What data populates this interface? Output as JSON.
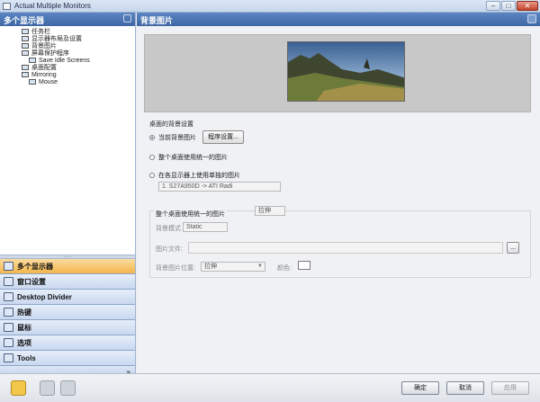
{
  "window": {
    "title": "Actual Multiple Monitors",
    "buttons": {
      "minimize": "–",
      "maximize": "□",
      "close": "✕"
    }
  },
  "left": {
    "header": "多个显示器",
    "tree": [
      {
        "label": "任务栏",
        "level": 2
      },
      {
        "label": "显示器布局及设置",
        "level": 2
      },
      {
        "label": "背景图片",
        "level": 2
      },
      {
        "label": "屏幕保护程序",
        "level": 2
      },
      {
        "label": "Save Idle Screens",
        "level": 3
      },
      {
        "label": "桌面配置",
        "level": 2
      },
      {
        "label": "Mirroring",
        "level": 2
      },
      {
        "label": "Mouse",
        "level": 3
      }
    ],
    "grip": "......",
    "nav": [
      {
        "label": "多个显示器",
        "active": true,
        "icon": "monitors-icon"
      },
      {
        "label": "窗口设置",
        "active": false,
        "icon": "window-icon"
      },
      {
        "label": "Desktop Divider",
        "active": false,
        "icon": "divider-icon"
      },
      {
        "label": "热键",
        "active": false,
        "icon": "keyboard-icon"
      },
      {
        "label": "鼠标",
        "active": false,
        "icon": "mouse-icon"
      },
      {
        "label": "选项",
        "active": false,
        "icon": "options-icon"
      },
      {
        "label": "Tools",
        "active": false,
        "icon": "tools-icon"
      }
    ],
    "nav_footer": "»"
  },
  "right": {
    "header": "背景图片",
    "section_label": "桌面的背景设置",
    "radio_current": "当前背景图片",
    "program_settings_button": "程序设置...",
    "radio_same": "整个桌面使用统一的图片",
    "radio_separate": "在各显示器上使用单独的图片",
    "monitor_select": "1. S27A950D -> ATI Radi",
    "group_title": "整个桌面使用统一的图片",
    "group_mode": "拉伸",
    "bg_mode_label": "背景模式",
    "bg_mode_value": "Static",
    "file_label": "图片文件:",
    "browse_button": "...",
    "position_label": "背景图片位置:",
    "position_value": "拉伸",
    "color_label": "颜色:"
  },
  "bottom": {
    "ok": "确定",
    "cancel": "取消",
    "apply": "应用"
  }
}
